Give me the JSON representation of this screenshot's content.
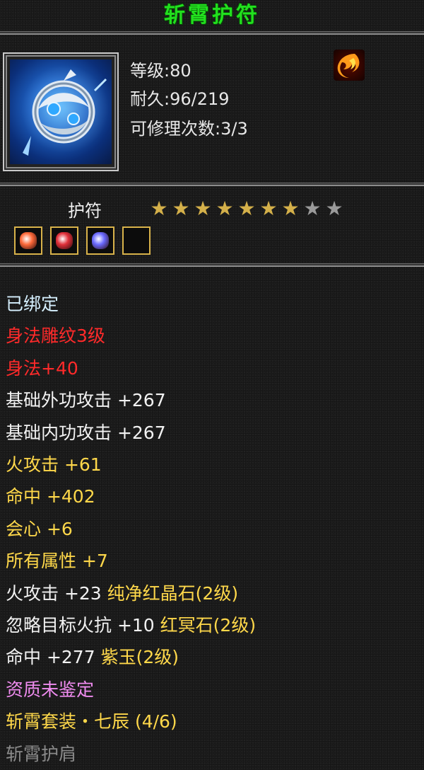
{
  "item": {
    "name": "斩霄护符",
    "level_line": "等级:80",
    "durability_line": "耐久:96/219",
    "repair_line": "可修理次数:3/3",
    "type": "护符",
    "stars_filled": 7,
    "stars_total": 9
  },
  "gem_slots": [
    {
      "name": "red-crystal-gem-icon",
      "color": "#ff6a3a"
    },
    {
      "name": "red-nether-gem-icon",
      "color": "#e0303a"
    },
    {
      "name": "purple-jade-gem-icon",
      "color": "#6a6aff"
    },
    {
      "name": "empty-slot",
      "color": "#0c0c0c"
    }
  ],
  "properties": [
    {
      "text": "已绑定",
      "color": "#d6f0ff"
    },
    {
      "text": "身法雕纹3级",
      "color": "#ff2a2a"
    },
    {
      "text": "身法+40",
      "color": "#ff2a2a"
    },
    {
      "text": "基础外功攻击 +267",
      "color": "#f2f2f2"
    },
    {
      "text": "基础内功攻击 +267",
      "color": "#f2f2f2"
    },
    {
      "text": "火攻击 +61",
      "color": "#ffd84a"
    },
    {
      "text": "命中 +402",
      "color": "#ffd84a"
    },
    {
      "text": "会心 +6",
      "color": "#ffd84a"
    },
    {
      "text": "所有属性 +7",
      "color": "#ffd84a"
    },
    {
      "text": "火攻击 +23 ",
      "extra": "纯净红晶石(2级)",
      "color": "#f2f2f2",
      "extra_color": "#ffd84a"
    },
    {
      "text": "忽略目标火抗 +10 ",
      "extra": "红冥石(2级)",
      "color": "#f2f2f2",
      "extra_color": "#ffd84a"
    },
    {
      "text": "命中 +277 ",
      "extra": "紫玉(2级)",
      "color": "#f2f2f2",
      "extra_color": "#ffd84a"
    },
    {
      "text": "资质未鉴定",
      "color": "#f08cf0"
    },
    {
      "text": "斩霄套装・七辰 (4/6)",
      "color": "#ffd84a"
    },
    {
      "text": "斩霄护肩",
      "color": "#8a8a8a"
    }
  ],
  "colors": {
    "title_green": "#22e01e",
    "star_gold": "#d4b04a",
    "star_gray": "#9a9a9a"
  }
}
